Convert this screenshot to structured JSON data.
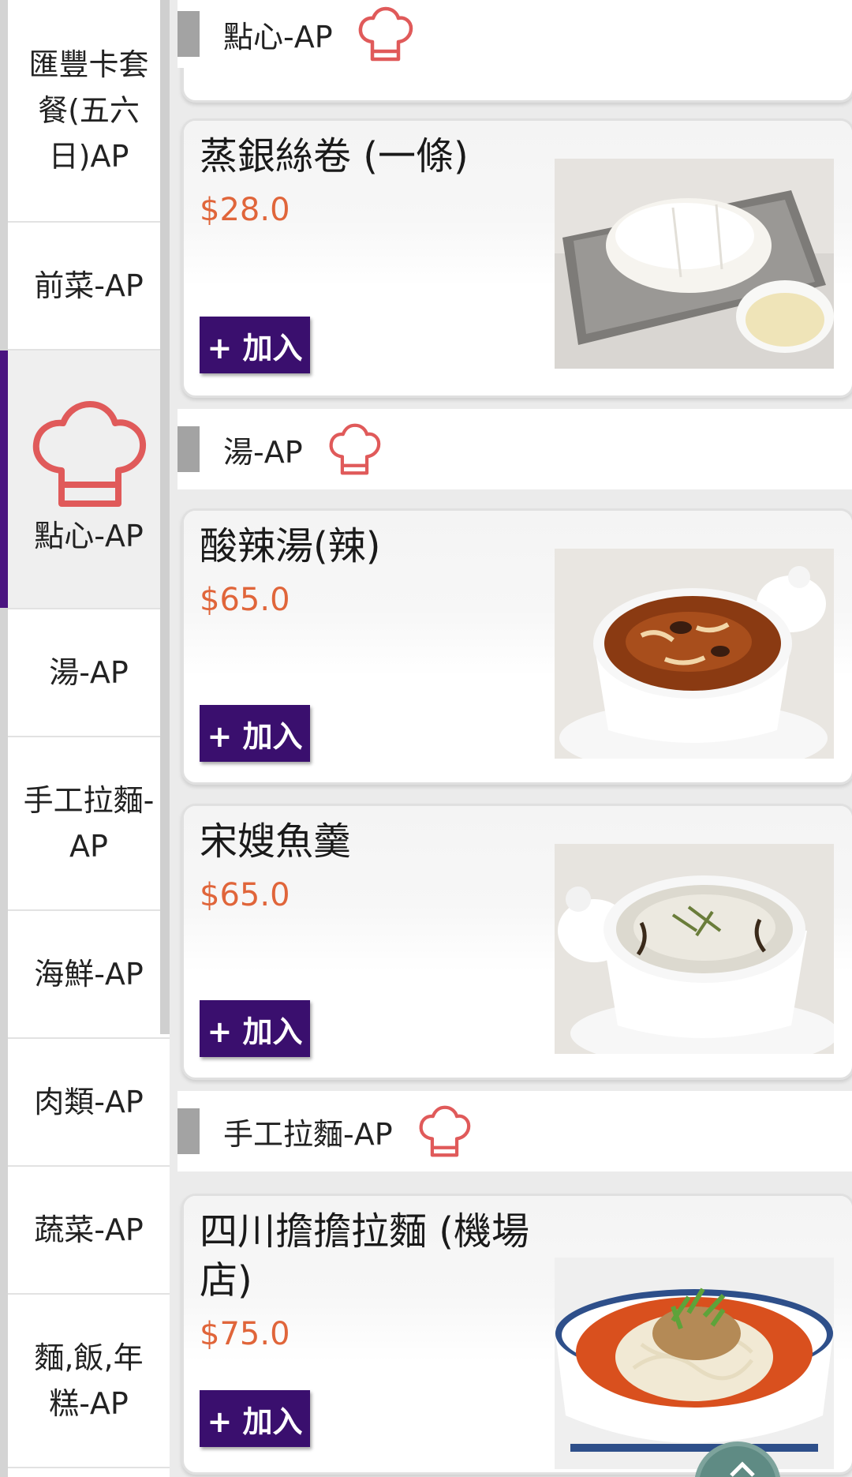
{
  "sidebar": {
    "items": [
      {
        "label": "匯豐卡套餐(五六日)AP"
      },
      {
        "label": "前菜-AP"
      },
      {
        "label": "點心-AP"
      },
      {
        "label": "湯-AP"
      },
      {
        "label": "手工拉麵-AP"
      },
      {
        "label": "海鮮-AP"
      },
      {
        "label": "肉類-AP"
      },
      {
        "label": "蔬菜-AP"
      },
      {
        "label": "麵,飯,年糕-AP"
      }
    ],
    "active_index": 2
  },
  "sections": {
    "dimsum": {
      "title": "點心-AP",
      "icon": "chef-hat-icon"
    },
    "soup": {
      "title": "湯-AP",
      "icon": "chef-hat-icon"
    },
    "noodles": {
      "title": "手工拉麵-AP",
      "icon": "chef-hat-icon"
    }
  },
  "items": [
    {
      "name": "蒸銀絲卷 (一條)",
      "price": "$28.0",
      "add_label": "+ 加入"
    },
    {
      "name": "酸辣湯(辣)",
      "price": "$65.0",
      "add_label": "+ 加入"
    },
    {
      "name": "宋嫂魚羹",
      "price": "$65.0",
      "add_label": "+ 加入"
    },
    {
      "name": "四川擔擔拉麵 (機場店)",
      "price": "$75.0",
      "add_label": "+ 加入"
    }
  ],
  "colors": {
    "accent_purple": "#3a0f6e",
    "price_orange": "#e0653a",
    "chef_icon_red": "#e05a5a",
    "active_indicator": "#4a1380"
  },
  "icons": {
    "scroll_top": "chevron-up-icon"
  }
}
